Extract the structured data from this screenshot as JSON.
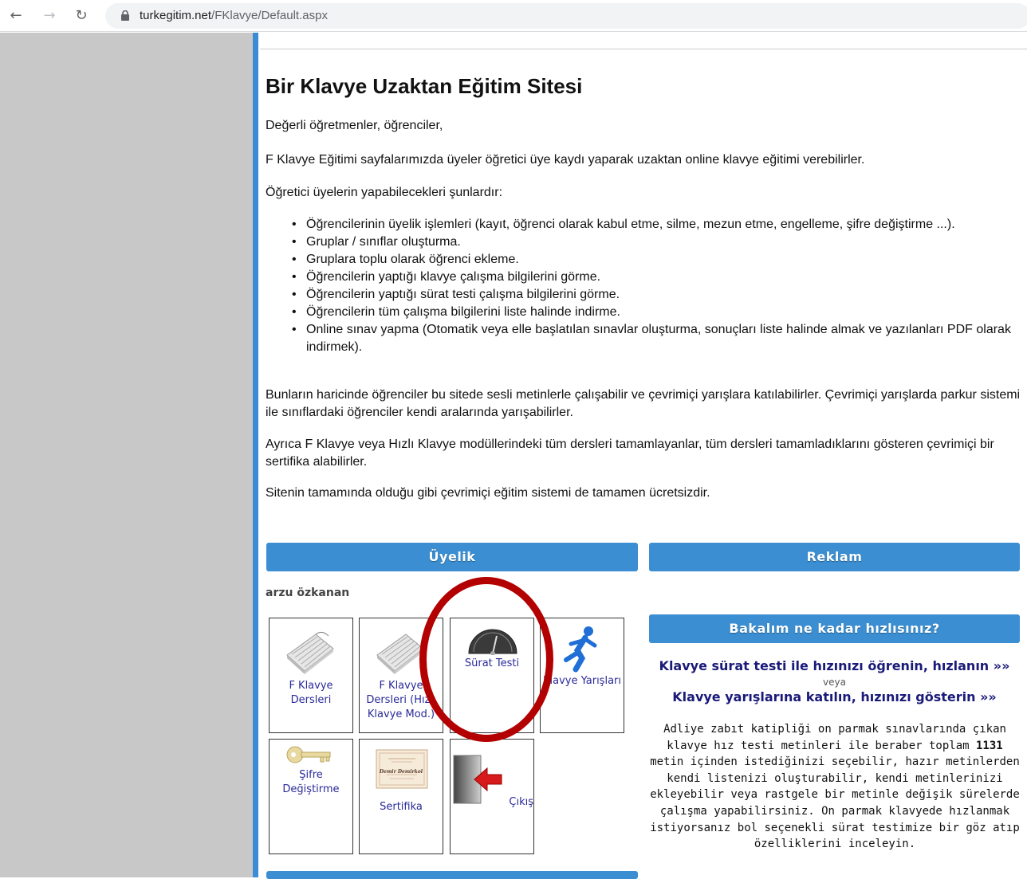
{
  "browser": {
    "url_host": "turkegitim.net",
    "url_path": "/FKlavye/Default.aspx"
  },
  "page": {
    "title": "Bir Klavye Uzaktan Eğitim Sitesi",
    "greeting": "Değerli öğretmenler, öğrenciler,",
    "intro": "F Klavye Eğitimi sayfalarımızda üyeler öğretici üye kaydı yaparak uzaktan online klavye eğitimi verebilirler.",
    "features_heading": "Öğretici üyelerin yapabilecekleri şunlardır:",
    "features": [
      "Öğrencilerinin üyelik işlemleri (kayıt, öğrenci olarak kabul etme, silme, mezun etme, engelleme, şifre değiştirme ...).",
      "Gruplar / sınıflar oluşturma.",
      "Gruplara toplu olarak öğrenci ekleme.",
      "Öğrencilerin yaptığı klavye çalışma bilgilerini görme.",
      "Öğrencilerin yaptığı sürat testi çalışma bilgilerini görme.",
      "Öğrencilerin tüm çalışma bilgilerini liste halinde indirme.",
      "Online sınav yapma (Otomatik veya elle başlatılan sınavlar oluşturma, sonuçları liste halinde almak ve yazılanları PDF olarak indirmek)."
    ],
    "para_extra": "Bunların haricinde öğrenciler bu sitede sesli metinlerle çalışabilir ve çevrimiçi yarışlara katılabilirler. Çevrimiçi yarışlarda parkur sistemi ile sınıflardaki öğrenciler kendi aralarında yarışabilirler.",
    "para_cert": "Ayrıca F Klavye veya Hızlı Klavye modüllerindeki tüm dersleri tamamlayanlar, tüm dersleri tamamladıklarını gösteren çevrimiçi bir sertifika alabilirler.",
    "para_free": "Sitenin tamamında olduğu gibi çevrimiçi eğitim sistemi de tamamen ücretsizdir."
  },
  "membership": {
    "header": "Üyelik",
    "username": "arzu özkanan",
    "tiles": {
      "fklavye_dersleri": "F Klavye Dersleri",
      "fklavye_hizli": "F Klavye Dersleri (Hızlı Klavye Mod.)",
      "surat_testi": "Sürat Testi",
      "klavye_yarislari": "Klavye Yarışları",
      "sifre": "Şifre Değiştirme",
      "sertifika": "Sertifika",
      "cikis": "Çıkış"
    },
    "cert_name": "Demir Demirkol"
  },
  "ads": {
    "header": "Reklam",
    "speed_header": "Bakalım ne kadar hızlısınız?",
    "link1": "Klavye sürat testi ile hızınızı öğrenin, hızlanın »»",
    "or": "veya",
    "link2": "Klavye yarışlarına katılın, hızınızı gösterin »»",
    "desc_before": "Adliye zabıt katipliği on parmak sınavlarında çıkan klavye hız testi metinleri ile beraber toplam ",
    "desc_count": "1131",
    "desc_after": " metin içinden istediğinizi seçebilir, hazır metinlerden kendi listenizi oluşturabilir, kendi metinlerinizi ekleyebilir veya rastgele bir metinle değişik sürelerde çalışma yapabilirsiniz. On parmak klavyede hızlanmak istiyorsanız bol seçenekli sürat testimize bir göz atıp özelliklerini inceleyin."
  },
  "colors": {
    "accent_blue": "#3a8ed1",
    "highlight_red": "#b30000",
    "link_navy": "#1a1a7a"
  }
}
